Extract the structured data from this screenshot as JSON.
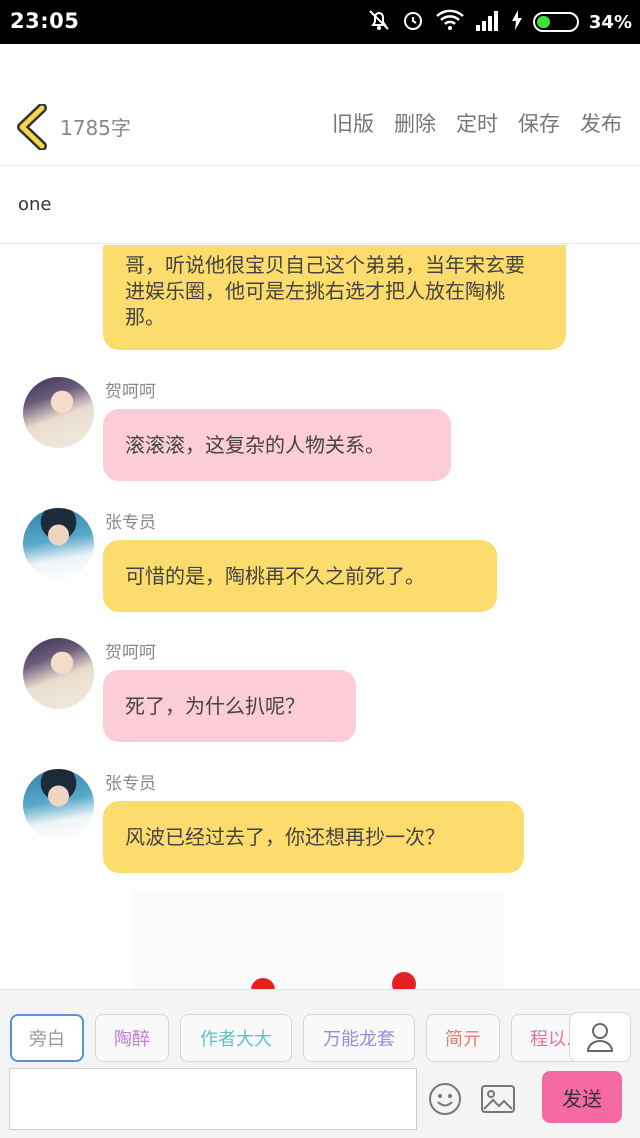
{
  "status": {
    "time": "23:05",
    "battery_pct": "34%",
    "battery_level": 0.34
  },
  "header": {
    "word_count": "1785字",
    "actions": [
      "旧版",
      "删除",
      "定时",
      "保存",
      "发布"
    ]
  },
  "doc": {
    "title": "one"
  },
  "chat": {
    "top_bubble": "哥，听说他很宝贝自己这个弟弟，当年宋玄要进娱乐圈，他可是左挑右选才把人放在陶桃那。",
    "messages": [
      {
        "name": "贺呵呵",
        "text": "滚滚滚，这复杂的人物关系。",
        "color": "pink"
      },
      {
        "name": "张专员",
        "text": "可惜的是，陶桃再不久之前死了。",
        "color": "yellow"
      },
      {
        "name": "贺呵呵",
        "text": "死了，为什么扒呢？",
        "color": "pink"
      },
      {
        "name": "张专员",
        "text": "风波已经过去了，你还想再抄一次？",
        "color": "yellow"
      }
    ]
  },
  "toolbar": {
    "roles": [
      {
        "label": "旁白",
        "color": "#9a9a9a"
      },
      {
        "label": "陶醉",
        "color": "#c27ad6"
      },
      {
        "label": "作者大大",
        "color": "#5fc1c4"
      },
      {
        "label": "万能龙套",
        "color": "#9b8ad9"
      },
      {
        "label": "简亓",
        "color": "#e77b6e"
      },
      {
        "label": "程以.",
        "color": "#e46fa2"
      }
    ],
    "send_label": "发送",
    "input_value": ""
  },
  "colors": {
    "yellow_bubble": "#fcdc6c",
    "pink_bubble": "#fccdd6",
    "send_button": "#f56aa5",
    "active_role_border": "#5b8fd6"
  }
}
